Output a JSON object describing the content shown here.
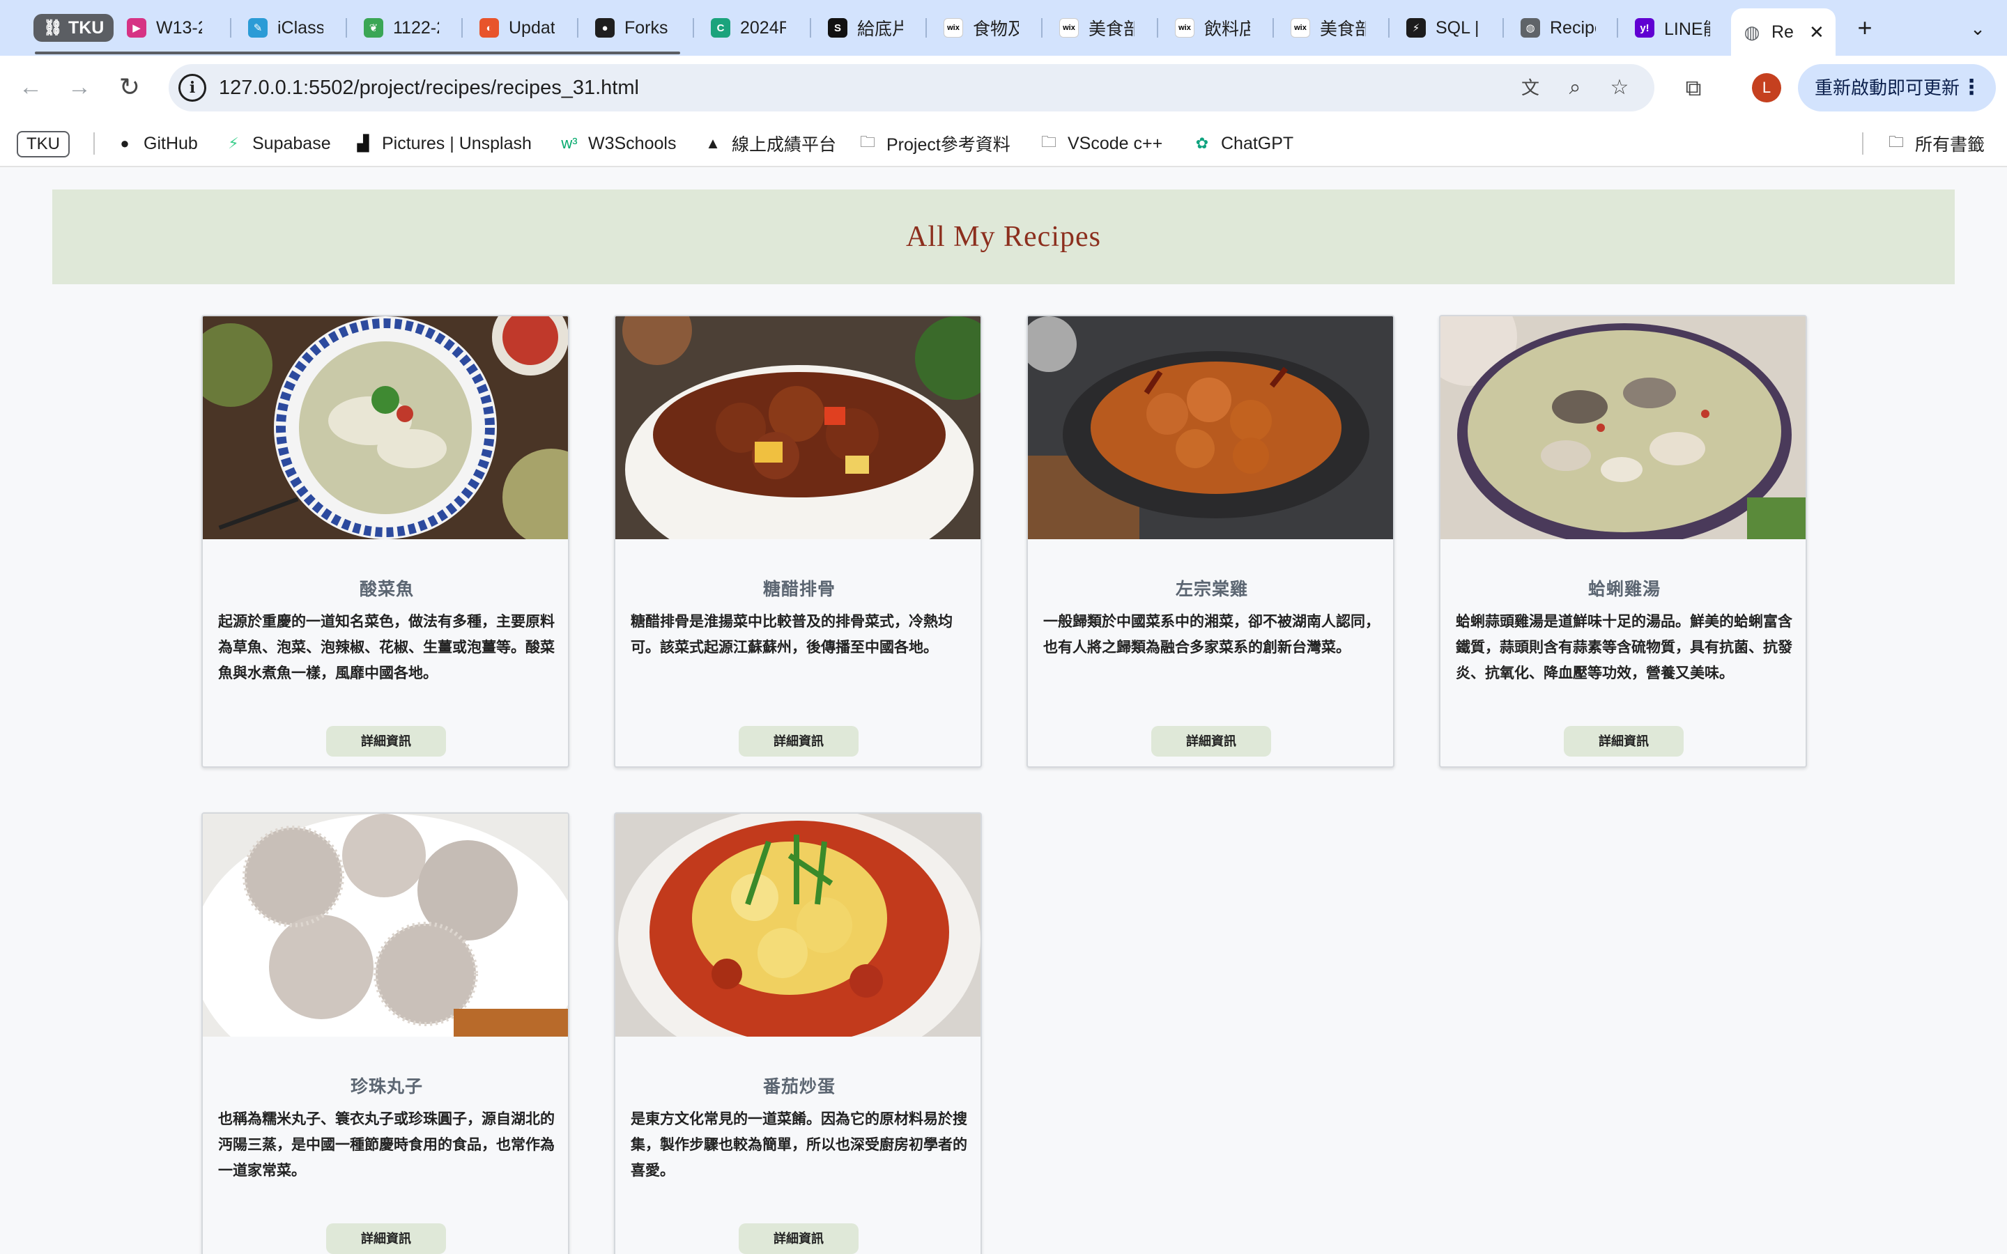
{
  "browser": {
    "tab_group_label": "TKU",
    "tabs": [
      {
        "title": "W13-2",
        "fav_color": "#d63384",
        "fav_char": "▶"
      },
      {
        "title": "iClass",
        "fav_color": "#2b9bd6",
        "fav_char": "✎"
      },
      {
        "title": "1122-2",
        "fav_color": "#3aa655",
        "fav_char": "❦"
      },
      {
        "title": "Updat",
        "fav_color": "#e8542b",
        "fav_char": "◐"
      },
      {
        "title": "Forks",
        "fav_color": "#1f1f1f",
        "fav_char": "●"
      },
      {
        "title": "2024R",
        "fav_color": "#1ba37c",
        "fav_char": "C"
      },
      {
        "title": "給底片",
        "fav_color": "#111111",
        "fav_char": "S"
      },
      {
        "title": "食物及",
        "fav_color": "#ffffff",
        "fav_char": "wix"
      },
      {
        "title": "美食部",
        "fav_color": "#ffffff",
        "fav_char": "wix"
      },
      {
        "title": "飲料店",
        "fav_color": "#ffffff",
        "fav_char": "wix"
      },
      {
        "title": "美食部",
        "fav_color": "#ffffff",
        "fav_char": "wix"
      },
      {
        "title": "SQL |",
        "fav_color": "#1c1c1c",
        "fav_char": "⚡"
      },
      {
        "title": "Recipe",
        "fav_color": "#5f6368",
        "fav_char": "◍"
      },
      {
        "title": "LINE能",
        "fav_color": "#6001d2",
        "fav_char": "y!"
      }
    ],
    "active_tab": {
      "title": "Re",
      "close": "✕"
    },
    "new_tab": "+",
    "url": "127.0.0.1:5502/project/recipes/recipes_31.html",
    "profile_initial": "L",
    "update_label": "重新啟動即可更新",
    "bookmarks": [
      {
        "label": "GitHub",
        "icon": "github-icon"
      },
      {
        "label": "Supabase",
        "icon": "supabase-icon"
      },
      {
        "label": "Pictures | Unsplash",
        "icon": "unsplash-icon"
      },
      {
        "label": "W3Schools",
        "icon": "w3schools-icon"
      },
      {
        "label": "線上成績平台",
        "icon": "triangle-icon"
      },
      {
        "label": "Project參考資料",
        "icon": "folder-icon"
      },
      {
        "label": "VScode c++",
        "icon": "folder-icon"
      },
      {
        "label": "ChatGPT",
        "icon": "chatgpt-icon"
      }
    ],
    "bookmark_tku": "TKU",
    "all_bookmarks": "所有書籤"
  },
  "page": {
    "title": "All My Recipes",
    "details_label": "詳細資訊",
    "recipes": [
      {
        "name": "酸菜魚",
        "description": "起源於重慶的一道知名菜色，做法有多種，主要原料為草魚、泡菜、泡辣椒、花椒、生薑或泡薑等。酸菜魚與水煮魚一樣，風靡中國各地。"
      },
      {
        "name": "糖醋排骨",
        "description": "糖醋排骨是淮揚菜中比較普及的排骨菜式，冷熱均可。該菜式起源江蘇蘇州，後傳播至中國各地。"
      },
      {
        "name": "左宗棠雞",
        "description": "一般歸類於中國菜系中的湘菜，卻不被湖南人認同，也有人將之歸類為融合多家菜系的創新台灣菜。"
      },
      {
        "name": "蛤蜊雞湯",
        "description": "蛤蜊蒜頭雞湯是道鮮味十足的湯品。鮮美的蛤蜊富含鐵質，蒜頭則含有蒜素等含硫物質，具有抗菌、抗發炎、抗氧化、降血壓等功效，營養又美味。"
      },
      {
        "name": "珍珠丸子",
        "description": "也稱為糯米丸子、簑衣丸子或珍珠圓子，源自湖北的沔陽三蒸，是中國一種節慶時食用的食品，也常作為一道家常菜。"
      },
      {
        "name": "番茄炒蛋",
        "description": "是東方文化常見的一道菜餚。因為它的原材料易於搜集，製作步驟也較為簡單，所以也深受廚房初學者的喜愛。"
      }
    ]
  }
}
